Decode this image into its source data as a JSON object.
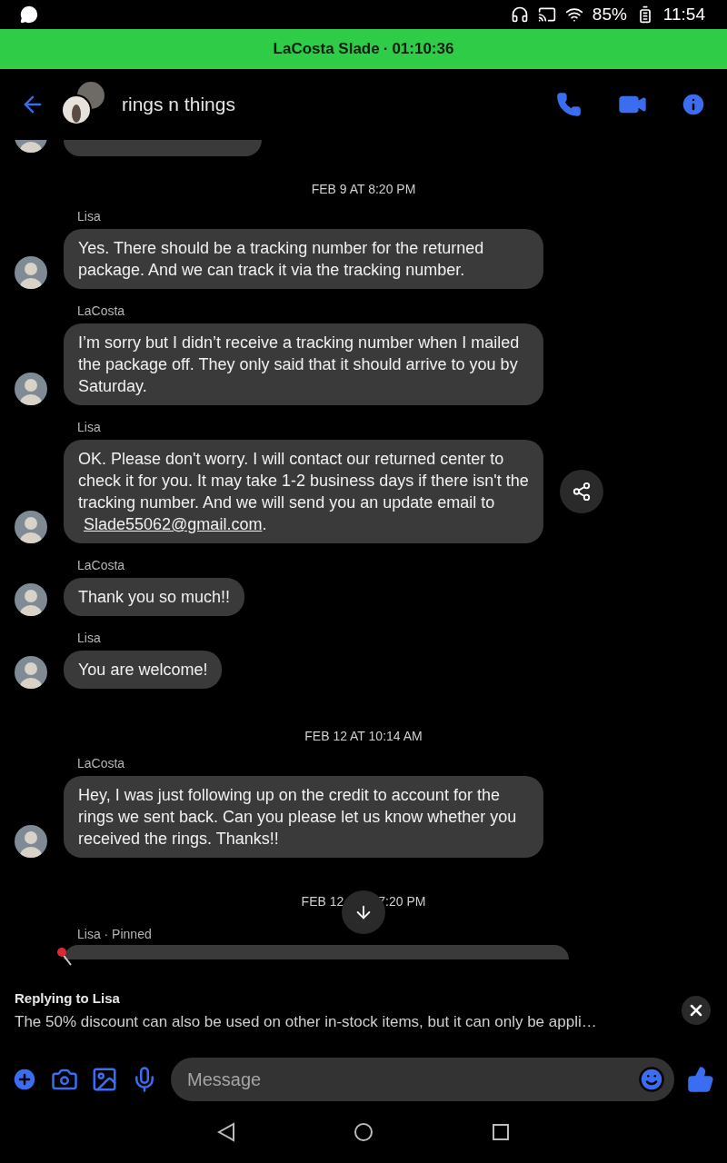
{
  "status_bar": {
    "battery": "85%",
    "time": "11:54"
  },
  "call_banner": {
    "name": "LaCosta Slade",
    "separator": "·",
    "duration": "01:10:36"
  },
  "header": {
    "title": "rings n things"
  },
  "feed": [
    {
      "kind": "clipped"
    },
    {
      "kind": "date",
      "text": "FEB 9 AT 8:20 PM"
    },
    {
      "kind": "message",
      "sender": "Lisa",
      "text": "Yes. There should be a tracking number for the returned package. And we can track it via the tracking number."
    },
    {
      "kind": "message",
      "sender": "LaCosta",
      "text": "I’m sorry but I didn’t receive a tracking number when I mailed the package off. They only said that it should arrive to you by Saturday."
    },
    {
      "kind": "message",
      "sender": "Lisa",
      "text": "OK. Please don't worry. I will contact our returned center to check it for you.  It may take 1-2 business days if there isn't the tracking number.  And we will send you an update email to ",
      "link": "Slade55062@gmail.com",
      "after": ".",
      "share": true
    },
    {
      "kind": "message",
      "sender": "LaCosta",
      "text": "Thank you so much!!"
    },
    {
      "kind": "message",
      "sender": "Lisa",
      "text": "You are welcome!"
    },
    {
      "kind": "date",
      "text": "FEB 12 AT 10:14 AM"
    },
    {
      "kind": "message",
      "sender": "LaCosta",
      "text": "Hey, I was just following up on the credit to account for the rings we sent back. Can you please let us know whether you received the rings. Thanks!!"
    },
    {
      "kind": "split_date",
      "left": "FEB 12",
      "right": "7:20 PM"
    },
    {
      "kind": "pinned",
      "sender": "Lisa · Pinned"
    }
  ],
  "reply": {
    "title": "Replying to Lisa",
    "text": "The 50% discount can also be used on other in-stock items, but it can only be appli…"
  },
  "composer": {
    "placeholder": "Message"
  }
}
